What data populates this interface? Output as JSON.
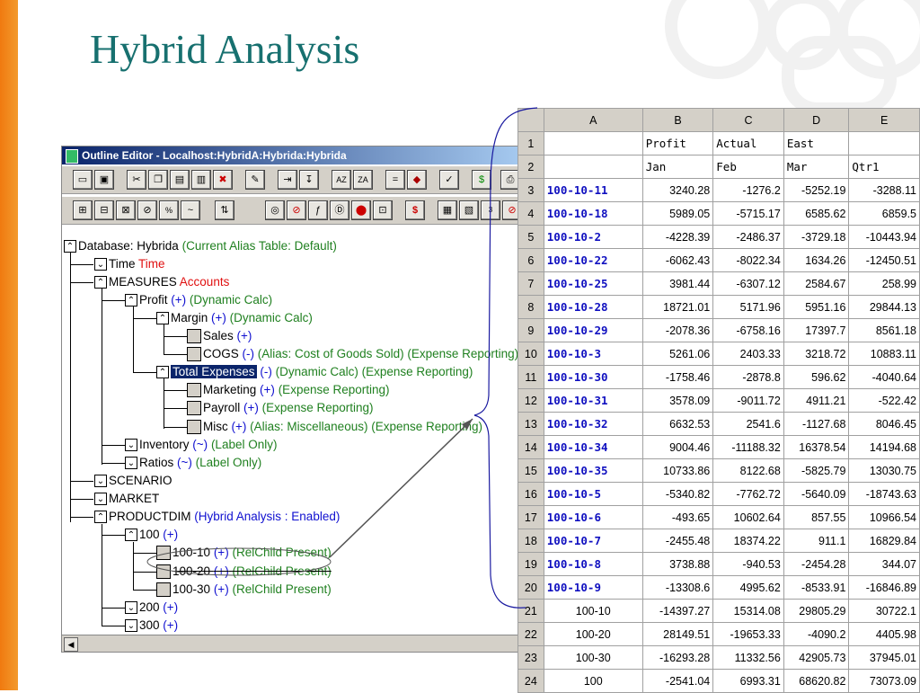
{
  "slide": {
    "title": "Hybrid Analysis"
  },
  "window": {
    "title": "Outline Editor - Localhost:HybridA:Hybrida:Hybrida"
  },
  "tree": {
    "database": {
      "label": "Database: Hybrida",
      "note": "(Current Alias Table: Default)"
    },
    "time": {
      "label": "Time",
      "tag": "Time"
    },
    "measures": {
      "label": "MEASURES",
      "tag": "Accounts"
    },
    "profit": {
      "label": "Profit",
      "op": "(+)",
      "note": "(Dynamic Calc)"
    },
    "margin": {
      "label": "Margin",
      "op": "(+)",
      "note": "(Dynamic Calc)"
    },
    "sales": {
      "label": "Sales",
      "op": "(+)"
    },
    "cogs": {
      "label": "COGS",
      "op": "(-)",
      "note": "(Alias: Cost of Goods Sold) (Expense Reporting)"
    },
    "total_expenses": {
      "label": "Total Expenses",
      "op": "(-)",
      "note": "(Dynamic Calc) (Expense Reporting)"
    },
    "marketing": {
      "label": "Marketing",
      "op": "(+)",
      "note": "(Expense Reporting)"
    },
    "payroll": {
      "label": "Payroll",
      "op": "(+)",
      "note": "(Expense Reporting)"
    },
    "misc": {
      "label": "Misc",
      "op": "(+)",
      "note": "(Alias: Miscellaneous) (Expense Reporting)"
    },
    "inventory": {
      "label": "Inventory",
      "op": "(~)",
      "note": "(Label Only)"
    },
    "ratios": {
      "label": "Ratios",
      "op": "(~)",
      "note": "(Label Only)"
    },
    "scenario": {
      "label": "SCENARIO"
    },
    "market": {
      "label": "MARKET"
    },
    "productdim": {
      "label": "PRODUCTDIM",
      "note": "(Hybrid Analysis : Enabled)"
    },
    "p100": {
      "label": "100",
      "op": "(+)"
    },
    "p100_10": {
      "label": "100-10",
      "op": "(+)",
      "note": "(RelChild Present)"
    },
    "p100_20": {
      "label": "100-20",
      "op": "(+)",
      "note": "(RelChild Present)"
    },
    "p100_30": {
      "label": "100-30",
      "op": "(+)",
      "note": "(RelChild Present)"
    },
    "p200": {
      "label": "200",
      "op": "(+)"
    },
    "p300": {
      "label": "300",
      "op": "(+)"
    }
  },
  "spreadsheet": {
    "columns": [
      "A",
      "B",
      "C",
      "D",
      "E"
    ],
    "rows": [
      {
        "n": "1",
        "a": "",
        "b": "Profit",
        "c": "Actual",
        "d": "East",
        "e": ""
      },
      {
        "n": "2",
        "a": "",
        "b": "Jan",
        "c": "Feb",
        "d": "Mar",
        "e": "Qtr1"
      },
      {
        "n": "3",
        "a": "100-10-11",
        "b": "3240.28",
        "c": "-1276.2",
        "d": "-5252.19",
        "e": "-3288.11"
      },
      {
        "n": "4",
        "a": "100-10-18",
        "b": "5989.05",
        "c": "-5715.17",
        "d": "6585.62",
        "e": "6859.5"
      },
      {
        "n": "5",
        "a": "100-10-2",
        "b": "-4228.39",
        "c": "-2486.37",
        "d": "-3729.18",
        "e": "-10443.94"
      },
      {
        "n": "6",
        "a": "100-10-22",
        "b": "-6062.43",
        "c": "-8022.34",
        "d": "1634.26",
        "e": "-12450.51"
      },
      {
        "n": "7",
        "a": "100-10-25",
        "b": "3981.44",
        "c": "-6307.12",
        "d": "2584.67",
        "e": "258.99"
      },
      {
        "n": "8",
        "a": "100-10-28",
        "b": "18721.01",
        "c": "5171.96",
        "d": "5951.16",
        "e": "29844.13"
      },
      {
        "n": "9",
        "a": "100-10-29",
        "b": "-2078.36",
        "c": "-6758.16",
        "d": "17397.7",
        "e": "8561.18"
      },
      {
        "n": "10",
        "a": "100-10-3",
        "b": "5261.06",
        "c": "2403.33",
        "d": "3218.72",
        "e": "10883.11"
      },
      {
        "n": "11",
        "a": "100-10-30",
        "b": "-1758.46",
        "c": "-2878.8",
        "d": "596.62",
        "e": "-4040.64"
      },
      {
        "n": "12",
        "a": "100-10-31",
        "b": "3578.09",
        "c": "-9011.72",
        "d": "4911.21",
        "e": "-522.42"
      },
      {
        "n": "13",
        "a": "100-10-32",
        "b": "6632.53",
        "c": "2541.6",
        "d": "-1127.68",
        "e": "8046.45"
      },
      {
        "n": "14",
        "a": "100-10-34",
        "b": "9004.46",
        "c": "-11188.32",
        "d": "16378.54",
        "e": "14194.68"
      },
      {
        "n": "15",
        "a": "100-10-35",
        "b": "10733.86",
        "c": "8122.68",
        "d": "-5825.79",
        "e": "13030.75"
      },
      {
        "n": "16",
        "a": "100-10-5",
        "b": "-5340.82",
        "c": "-7762.72",
        "d": "-5640.09",
        "e": "-18743.63"
      },
      {
        "n": "17",
        "a": "100-10-6",
        "b": "-493.65",
        "c": "10602.64",
        "d": "857.55",
        "e": "10966.54"
      },
      {
        "n": "18",
        "a": "100-10-7",
        "b": "-2455.48",
        "c": "18374.22",
        "d": "911.1",
        "e": "16829.84"
      },
      {
        "n": "19",
        "a": "100-10-8",
        "b": "3738.88",
        "c": "-940.53",
        "d": "-2454.28",
        "e": "344.07"
      },
      {
        "n": "20",
        "a": "100-10-9",
        "b": "-13308.6",
        "c": "4995.62",
        "d": "-8533.91",
        "e": "-16846.89"
      },
      {
        "n": "21",
        "a": "100-10",
        "b": "-14397.27",
        "c": "15314.08",
        "d": "29805.29",
        "e": "30722.1"
      },
      {
        "n": "22",
        "a": "100-20",
        "b": "28149.51",
        "c": "-19653.33",
        "d": "-4090.2",
        "e": "4405.98"
      },
      {
        "n": "23",
        "a": "100-30",
        "b": "-16293.28",
        "c": "11332.56",
        "d": "42905.73",
        "e": "37945.01"
      },
      {
        "n": "24",
        "a": "100",
        "b": "-2541.04",
        "c": "6993.31",
        "d": "68620.82",
        "e": "73073.09"
      }
    ]
  },
  "colors": {
    "title": "#17706f",
    "accent_bar": "#f07a10",
    "tag_red": "#e01010",
    "op_blue": "#1010d0",
    "note_green": "#208020",
    "selection": "#0a246a"
  }
}
